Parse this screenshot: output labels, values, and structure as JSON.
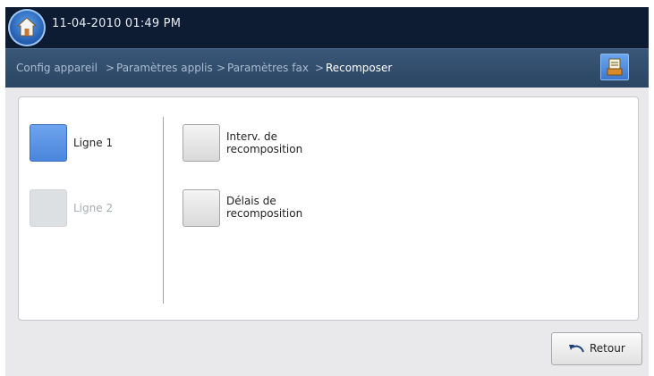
{
  "header": {
    "datetime": "11-04-2010 01:49 PM"
  },
  "breadcrumb": {
    "items": [
      "Config appareil",
      "Paramètres applis",
      "Paramètres fax",
      "Recomposer"
    ],
    "separator": ">"
  },
  "lines": [
    {
      "label": "Ligne 1",
      "selected": true,
      "enabled": true
    },
    {
      "label": "Ligne 2",
      "selected": false,
      "enabled": false
    }
  ],
  "options": [
    {
      "label_line1": "Interv. de",
      "label_line2": "recomposition"
    },
    {
      "label_line1": "Délais de",
      "label_line2": "recomposition"
    }
  ],
  "footer": {
    "back_label": "Retour"
  },
  "icons": {
    "home": "home-icon",
    "jobs": "job-status-icon",
    "back": "undo-arrow-icon"
  },
  "colors": {
    "topbar": "#0d1c33",
    "crumbbar": "#2b4562",
    "accent": "#4a86dc"
  }
}
